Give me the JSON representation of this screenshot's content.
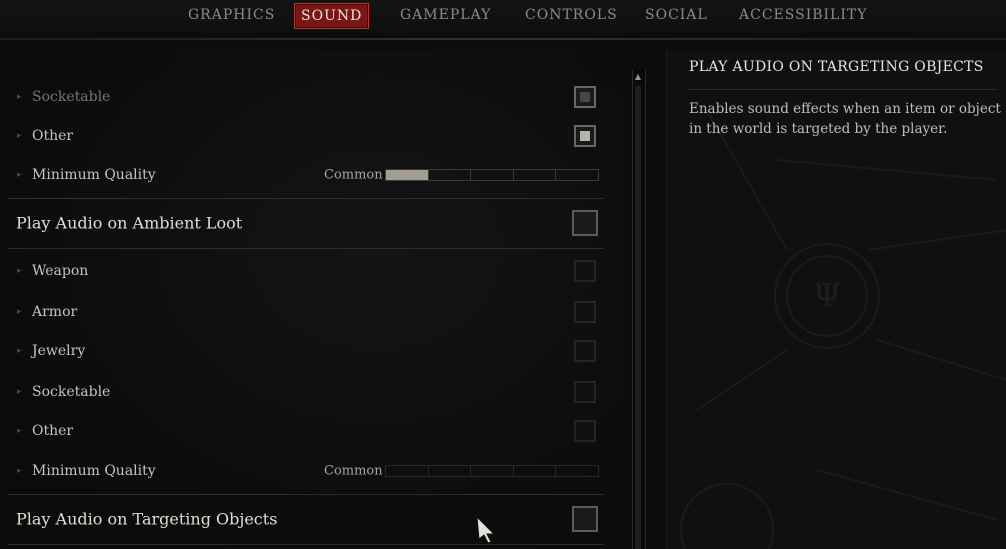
{
  "nav": {
    "tabs": [
      "GRAPHICS",
      "SOUND",
      "GAMEPLAY",
      "CONTROLS",
      "SOCIAL",
      "ACCESSIBILITY"
    ],
    "active": "SOUND"
  },
  "settings": {
    "group1": {
      "socketable": "Socketable",
      "other": "Other",
      "min_quality": "Minimum Quality",
      "quality_value": "Common",
      "quality_level": 1,
      "quality_max": 5
    },
    "ambient_loot": {
      "label": "Play Audio on Ambient Loot",
      "weapon": "Weapon",
      "armor": "Armor",
      "jewelry": "Jewelry",
      "socketable": "Socketable",
      "other": "Other",
      "min_quality": "Minimum Quality",
      "quality_value": "Common",
      "quality_level": 0,
      "quality_max": 5
    },
    "targeting": {
      "label": "Play Audio on Targeting Objects"
    }
  },
  "detail": {
    "title": "PLAY AUDIO ON TARGETING OBJECTS",
    "description": "Enables sound effects when an item or object in the world is targeted by the player."
  },
  "colors": {
    "accent": "#7a1616",
    "background": "#0c0c0d",
    "text": "#c9c4bb"
  }
}
